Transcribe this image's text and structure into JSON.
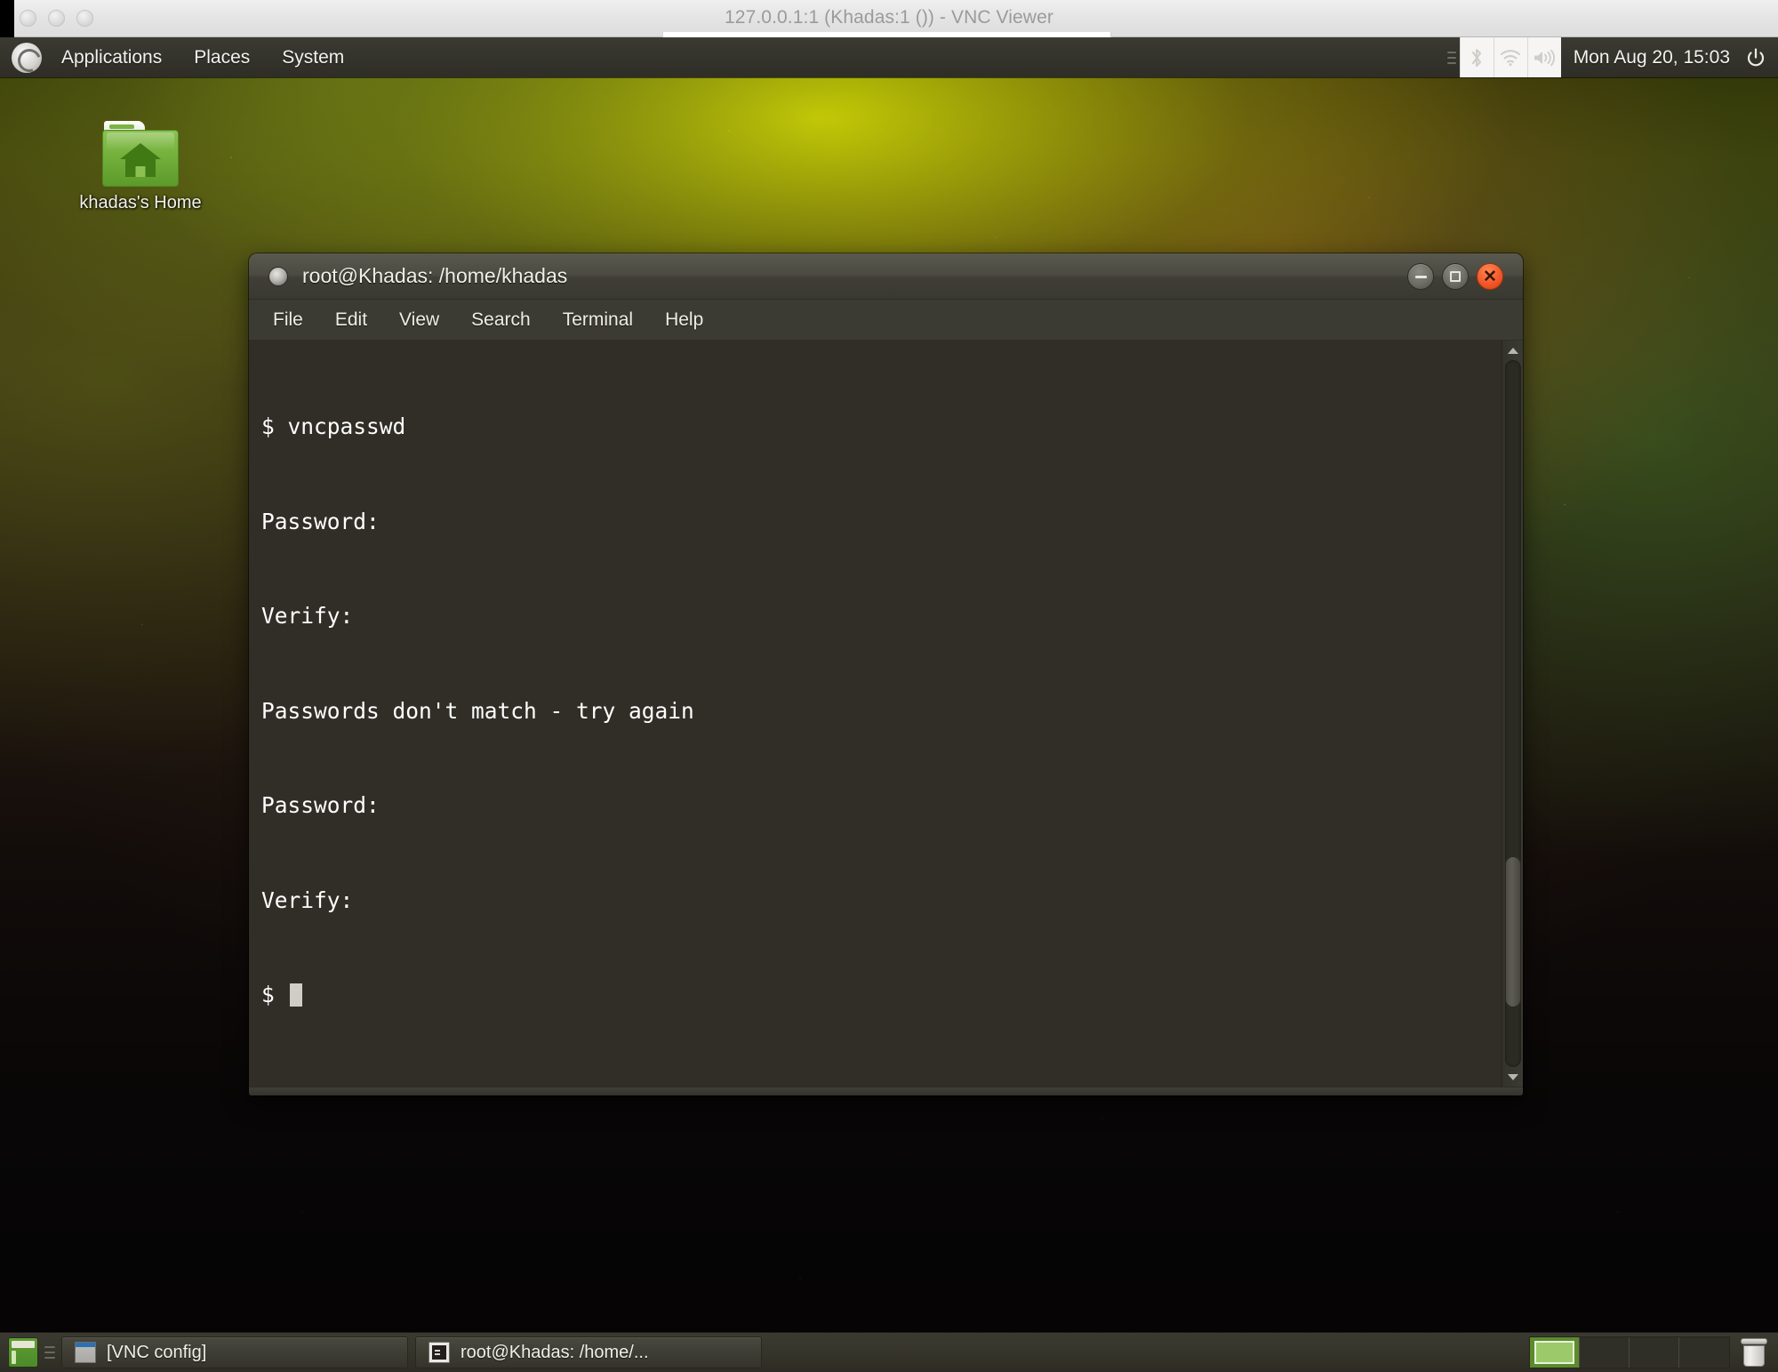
{
  "outer_window": {
    "title": "127.0.0.1:1 (Khadas:1 ()) - VNC Viewer",
    "lights": [
      "close-light",
      "minimize-light",
      "zoom-light"
    ]
  },
  "panel": {
    "logo_icon": "ubuntu-logo-icon",
    "menus": [
      {
        "label": "Applications",
        "name": "menu-applications"
      },
      {
        "label": "Places",
        "name": "menu-places"
      },
      {
        "label": "System",
        "name": "menu-system"
      }
    ],
    "tray": [
      {
        "icon": "bluetooth-icon",
        "name": "tray-bluetooth"
      },
      {
        "icon": "wifi-icon",
        "name": "tray-network"
      },
      {
        "icon": "volume-icon",
        "name": "tray-volume"
      }
    ],
    "clock": "Mon Aug 20, 15:03",
    "power_icon": "power-icon"
  },
  "desktop": {
    "icons": [
      {
        "label": "khadas's Home",
        "icon": "home-folder-icon"
      }
    ]
  },
  "terminal": {
    "title": "root@Khadas: /home/khadas",
    "window_controls": {
      "minimize": "minimize-icon",
      "maximize": "maximize-icon",
      "close": "close-icon",
      "close_color": "#f4572a"
    },
    "menus": [
      "File",
      "Edit",
      "View",
      "Search",
      "Terminal",
      "Help"
    ],
    "background_color": "#302e26",
    "foreground_color": "#ffffff",
    "lines": [
      "$ vncpasswd",
      "Password:",
      "Verify:",
      "Passwords don't match - try again",
      "Password:",
      "Verify:",
      "$ "
    ],
    "cursor_visible": true
  },
  "taskbar": {
    "show_desktop_icon": "show-desktop-icon",
    "tasks": [
      {
        "label": "[VNC config]",
        "icon": "window-icon"
      },
      {
        "label": "root@Khadas: /home/...",
        "icon": "terminal-icon"
      }
    ],
    "workspaces": {
      "count": 4,
      "active_index": 0,
      "active_color": "#9cc96a"
    },
    "trash_icon": "trash-icon"
  }
}
